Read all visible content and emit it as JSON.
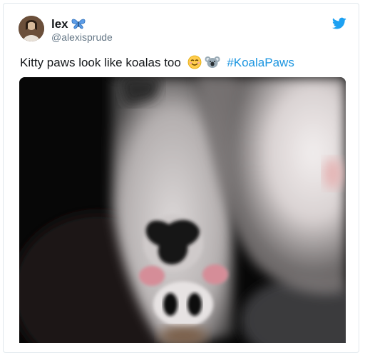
{
  "user": {
    "name": "lex",
    "handle": "@alexisprude",
    "name_emoji": "butterfly-icon"
  },
  "tweet": {
    "text": "Kitty paws look like koalas too",
    "emojis": [
      "smiling-face-icon",
      "koala-icon"
    ],
    "hashtag": "#KoalaPaws"
  },
  "brand": {
    "icon": "twitter-bird-icon",
    "color": "#1da1f2",
    "link_color": "#1b95e0"
  },
  "media": {
    "subject": "photo-cat-paw"
  }
}
